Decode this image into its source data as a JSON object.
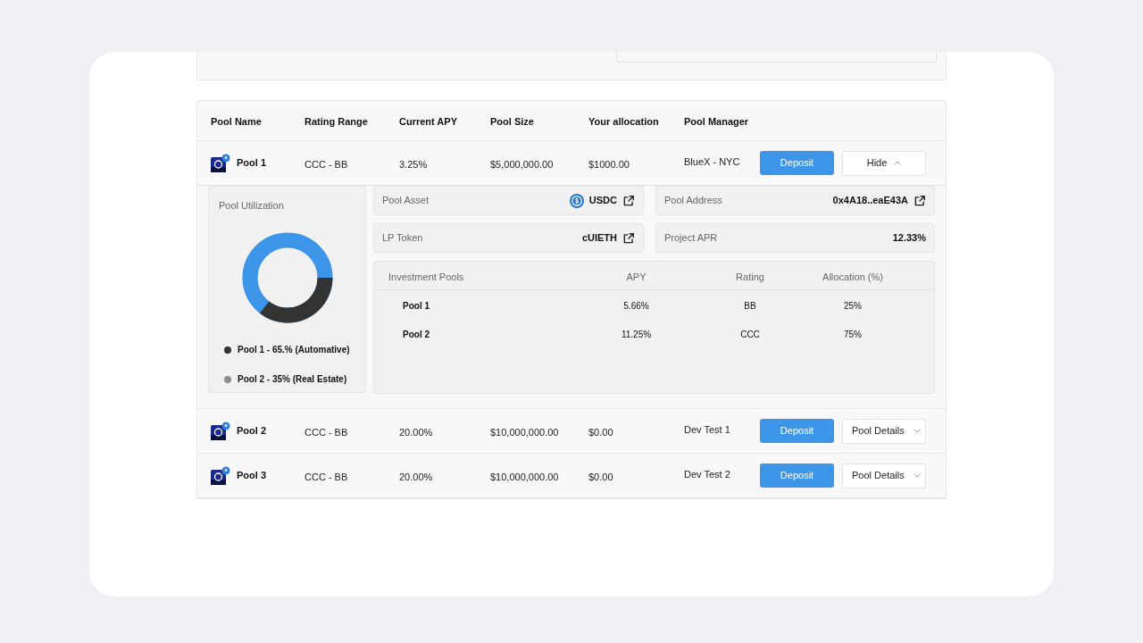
{
  "table": {
    "columns": [
      "Pool Name",
      "Rating Range",
      "Current APY",
      "Pool Size",
      "Your allocation",
      "Pool Manager"
    ],
    "rows": [
      {
        "name": "Pool 1",
        "rating_range": "CCC - BB",
        "current_apy": "3.25%",
        "pool_size": "$5,000,000.00",
        "your_allocation": "$1000.00",
        "pool_manager": "BlueX - NYC",
        "deposit": "Deposit",
        "toggle": "Hide",
        "expanded": true
      },
      {
        "name": "Pool 2",
        "rating_range": "CCC - BB",
        "current_apy": "20.00%",
        "pool_size": "$10,000,000.00",
        "your_allocation": "$0.00",
        "pool_manager": "Dev Test 1",
        "deposit": "Deposit",
        "toggle": "Pool Details",
        "expanded": false
      },
      {
        "name": "Pool 3",
        "rating_range": "CCC - BB",
        "current_apy": "20.00%",
        "pool_size": "$10,000,000.00",
        "your_allocation": "$0.00",
        "pool_manager": "Dev Test 2",
        "deposit": "Deposit",
        "toggle": "Pool Details",
        "expanded": false
      }
    ]
  },
  "details": {
    "utilization": {
      "title": "Pool Utilization",
      "legend": [
        {
          "label": "Pool 1 -  65.% (Automative)",
          "color": "#333333"
        },
        {
          "label": "Pool 2 - 35% (Real Estate)",
          "color": "#8c8c8c"
        }
      ]
    },
    "pool_asset": {
      "label": "Pool Asset",
      "value": "USDC"
    },
    "pool_address": {
      "label": "Pool Address",
      "value": "0x4A18..eaE43A"
    },
    "lp_token": {
      "label": "LP Token",
      "value": "cUIETH"
    },
    "project_apr": {
      "label": "Project APR",
      "value": "12.33%"
    },
    "investment_pools": {
      "columns": [
        "Investment Pools",
        "APY",
        "Rating",
        "Allocation (%)"
      ],
      "rows": [
        [
          "Pool 1",
          "5.66%",
          "BB",
          "25%"
        ],
        [
          "Pool 2",
          "11.25%",
          "CCC",
          "75%"
        ]
      ]
    }
  }
}
